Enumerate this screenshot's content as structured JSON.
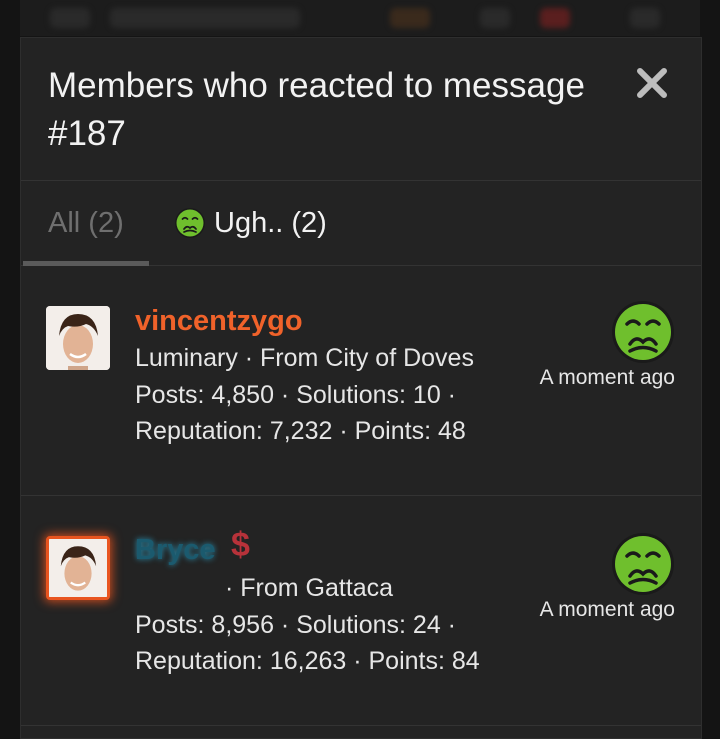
{
  "dialog": {
    "title": "Members who reacted to message #187",
    "close_icon": "close-icon"
  },
  "tabs": [
    {
      "label": "All (2)",
      "active": true
    },
    {
      "label": "Ugh.. (2)",
      "icon": "sick-face-icon"
    }
  ],
  "members": [
    {
      "username": "vincentzygo",
      "title_line": "Luminary · From City of Doves",
      "stats_line1": "Posts: 4,850 · Solutions: 10 ·",
      "stats_line2": "Reputation: 7,232 · Points: 48",
      "reaction": "sick-face-icon",
      "time": "A moment ago",
      "name_color": "#f0622a"
    },
    {
      "username": "Bryce",
      "badge": "$",
      "title_line": "· From Gattaca",
      "stats_line1": "Posts: 8,956 · Solutions: 24 ·",
      "stats_line2": "Reputation: 16,263 · Points: 84",
      "reaction": "sick-face-icon",
      "time": "A moment ago",
      "name_color": "#1b5a6e"
    }
  ],
  "colors": {
    "background": "#232323",
    "accent_orange": "#f0622a",
    "emoji_green": "#6fbf2d"
  }
}
